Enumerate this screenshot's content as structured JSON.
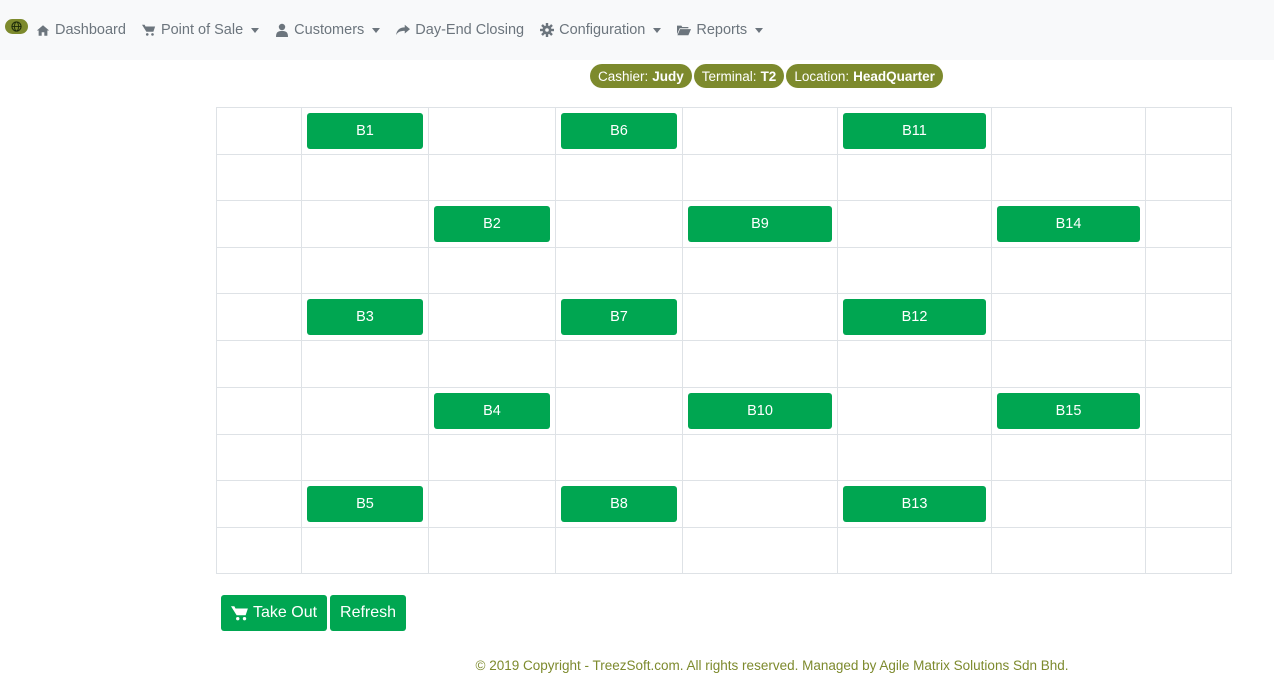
{
  "nav": {
    "items": [
      {
        "label": "Dashboard",
        "icon": "home-icon",
        "dropdown": false
      },
      {
        "label": "Point of Sale",
        "icon": "cart-icon",
        "dropdown": true
      },
      {
        "label": "Customers",
        "icon": "user-icon",
        "dropdown": true
      },
      {
        "label": "Day-End Closing",
        "icon": "share-icon",
        "dropdown": false
      },
      {
        "label": "Configuration",
        "icon": "gear-icon",
        "dropdown": true
      },
      {
        "label": "Reports",
        "icon": "folder-icon",
        "dropdown": true
      }
    ]
  },
  "session": {
    "cashier_label": "Cashier:",
    "cashier": "Judy",
    "terminal_label": "Terminal:",
    "terminal": "T2",
    "location_label": "Location:",
    "location": "HeadQuarter"
  },
  "tables": {
    "b1": "B1",
    "b2": "B2",
    "b3": "B3",
    "b4": "B4",
    "b5": "B5",
    "b6": "B6",
    "b7": "B7",
    "b8": "B8",
    "b9": "B9",
    "b10": "B10",
    "b11": "B11",
    "b12": "B12",
    "b13": "B13",
    "b14": "B14",
    "b15": "B15"
  },
  "actions": {
    "take_out": "Take Out",
    "refresh": "Refresh"
  },
  "footer": {
    "text": "© 2019 Copyright - TreezSoft.com. All rights reserved. Managed by Agile Matrix Solutions Sdn Bhd."
  },
  "colors": {
    "accent": "#7d8a2d",
    "table_button": "#00a651",
    "navbar_bg": "#f8f9fa"
  }
}
